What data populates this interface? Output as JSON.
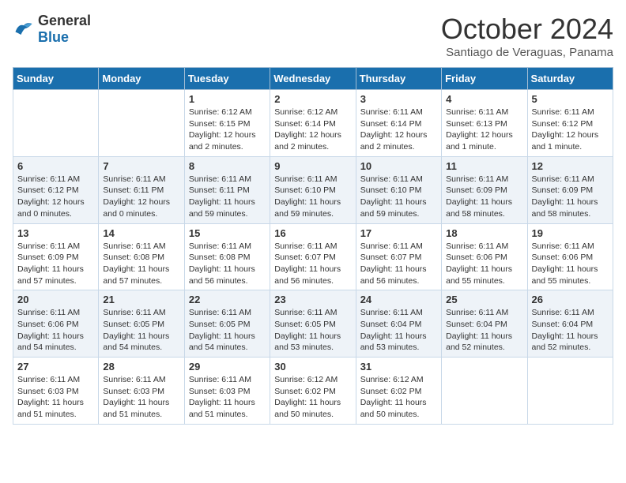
{
  "header": {
    "logo": {
      "general": "General",
      "blue": "Blue"
    },
    "title": "October 2024",
    "location": "Santiago de Veraguas, Panama"
  },
  "days_of_week": [
    "Sunday",
    "Monday",
    "Tuesday",
    "Wednesday",
    "Thursday",
    "Friday",
    "Saturday"
  ],
  "weeks": [
    [
      {
        "day": "",
        "content": ""
      },
      {
        "day": "",
        "content": ""
      },
      {
        "day": "1",
        "content": "Sunrise: 6:12 AM\nSunset: 6:15 PM\nDaylight: 12 hours and 2 minutes."
      },
      {
        "day": "2",
        "content": "Sunrise: 6:12 AM\nSunset: 6:14 PM\nDaylight: 12 hours and 2 minutes."
      },
      {
        "day": "3",
        "content": "Sunrise: 6:11 AM\nSunset: 6:14 PM\nDaylight: 12 hours and 2 minutes."
      },
      {
        "day": "4",
        "content": "Sunrise: 6:11 AM\nSunset: 6:13 PM\nDaylight: 12 hours and 1 minute."
      },
      {
        "day": "5",
        "content": "Sunrise: 6:11 AM\nSunset: 6:12 PM\nDaylight: 12 hours and 1 minute."
      }
    ],
    [
      {
        "day": "6",
        "content": "Sunrise: 6:11 AM\nSunset: 6:12 PM\nDaylight: 12 hours and 0 minutes."
      },
      {
        "day": "7",
        "content": "Sunrise: 6:11 AM\nSunset: 6:11 PM\nDaylight: 12 hours and 0 minutes."
      },
      {
        "day": "8",
        "content": "Sunrise: 6:11 AM\nSunset: 6:11 PM\nDaylight: 11 hours and 59 minutes."
      },
      {
        "day": "9",
        "content": "Sunrise: 6:11 AM\nSunset: 6:10 PM\nDaylight: 11 hours and 59 minutes."
      },
      {
        "day": "10",
        "content": "Sunrise: 6:11 AM\nSunset: 6:10 PM\nDaylight: 11 hours and 59 minutes."
      },
      {
        "day": "11",
        "content": "Sunrise: 6:11 AM\nSunset: 6:09 PM\nDaylight: 11 hours and 58 minutes."
      },
      {
        "day": "12",
        "content": "Sunrise: 6:11 AM\nSunset: 6:09 PM\nDaylight: 11 hours and 58 minutes."
      }
    ],
    [
      {
        "day": "13",
        "content": "Sunrise: 6:11 AM\nSunset: 6:09 PM\nDaylight: 11 hours and 57 minutes."
      },
      {
        "day": "14",
        "content": "Sunrise: 6:11 AM\nSunset: 6:08 PM\nDaylight: 11 hours and 57 minutes."
      },
      {
        "day": "15",
        "content": "Sunrise: 6:11 AM\nSunset: 6:08 PM\nDaylight: 11 hours and 56 minutes."
      },
      {
        "day": "16",
        "content": "Sunrise: 6:11 AM\nSunset: 6:07 PM\nDaylight: 11 hours and 56 minutes."
      },
      {
        "day": "17",
        "content": "Sunrise: 6:11 AM\nSunset: 6:07 PM\nDaylight: 11 hours and 56 minutes."
      },
      {
        "day": "18",
        "content": "Sunrise: 6:11 AM\nSunset: 6:06 PM\nDaylight: 11 hours and 55 minutes."
      },
      {
        "day": "19",
        "content": "Sunrise: 6:11 AM\nSunset: 6:06 PM\nDaylight: 11 hours and 55 minutes."
      }
    ],
    [
      {
        "day": "20",
        "content": "Sunrise: 6:11 AM\nSunset: 6:06 PM\nDaylight: 11 hours and 54 minutes."
      },
      {
        "day": "21",
        "content": "Sunrise: 6:11 AM\nSunset: 6:05 PM\nDaylight: 11 hours and 54 minutes."
      },
      {
        "day": "22",
        "content": "Sunrise: 6:11 AM\nSunset: 6:05 PM\nDaylight: 11 hours and 54 minutes."
      },
      {
        "day": "23",
        "content": "Sunrise: 6:11 AM\nSunset: 6:05 PM\nDaylight: 11 hours and 53 minutes."
      },
      {
        "day": "24",
        "content": "Sunrise: 6:11 AM\nSunset: 6:04 PM\nDaylight: 11 hours and 53 minutes."
      },
      {
        "day": "25",
        "content": "Sunrise: 6:11 AM\nSunset: 6:04 PM\nDaylight: 11 hours and 52 minutes."
      },
      {
        "day": "26",
        "content": "Sunrise: 6:11 AM\nSunset: 6:04 PM\nDaylight: 11 hours and 52 minutes."
      }
    ],
    [
      {
        "day": "27",
        "content": "Sunrise: 6:11 AM\nSunset: 6:03 PM\nDaylight: 11 hours and 51 minutes."
      },
      {
        "day": "28",
        "content": "Sunrise: 6:11 AM\nSunset: 6:03 PM\nDaylight: 11 hours and 51 minutes."
      },
      {
        "day": "29",
        "content": "Sunrise: 6:11 AM\nSunset: 6:03 PM\nDaylight: 11 hours and 51 minutes."
      },
      {
        "day": "30",
        "content": "Sunrise: 6:12 AM\nSunset: 6:02 PM\nDaylight: 11 hours and 50 minutes."
      },
      {
        "day": "31",
        "content": "Sunrise: 6:12 AM\nSunset: 6:02 PM\nDaylight: 11 hours and 50 minutes."
      },
      {
        "day": "",
        "content": ""
      },
      {
        "day": "",
        "content": ""
      }
    ]
  ]
}
